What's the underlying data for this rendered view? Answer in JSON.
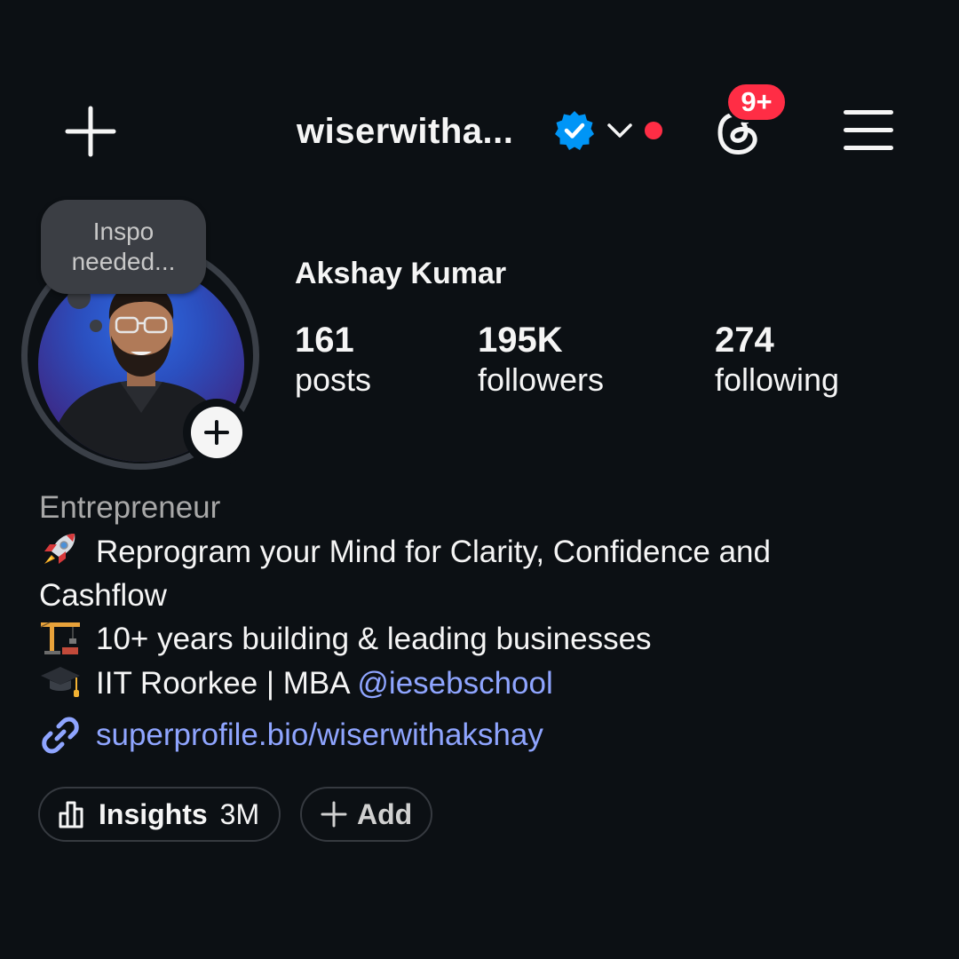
{
  "header": {
    "username": "wiserwitha...",
    "threads_badge": "9+"
  },
  "profile": {
    "note": [
      "Inspo",
      "needed..."
    ],
    "full_name": "Akshay Kumar",
    "stats": [
      {
        "value": "161",
        "label": "posts"
      },
      {
        "value": "195K",
        "label": "followers"
      },
      {
        "value": "274",
        "label": "following"
      }
    ]
  },
  "bio": {
    "category": "Entrepreneur",
    "line1": "Reprogram your Mind for Clarity, Confidence and",
    "line1b": "Cashflow",
    "line2": "10+ years building & leading businesses",
    "line3": "IIT Roorkee | MBA ",
    "line3_mention": "@iesebschool",
    "link": "superprofile.bio/wiserwithakshay"
  },
  "buttons": {
    "insights_label": "Insights",
    "insights_count": "3M",
    "add_label": "Add"
  },
  "colors": {
    "background": "#0c1014",
    "link": "#8fa5ff",
    "badge": "#ff2d45",
    "verified": "#0095f6"
  },
  "icons": {
    "add": "plus-icon",
    "verified": "verified-badge-icon",
    "dropdown": "chevron-down-icon",
    "threads": "threads-icon",
    "menu": "hamburger-menu-icon",
    "link": "link-icon",
    "insights": "bar-chart-icon",
    "bio_emoji": [
      "rocket-emoji-icon",
      "construction-crane-emoji-icon",
      "graduation-cap-emoji-icon"
    ]
  }
}
